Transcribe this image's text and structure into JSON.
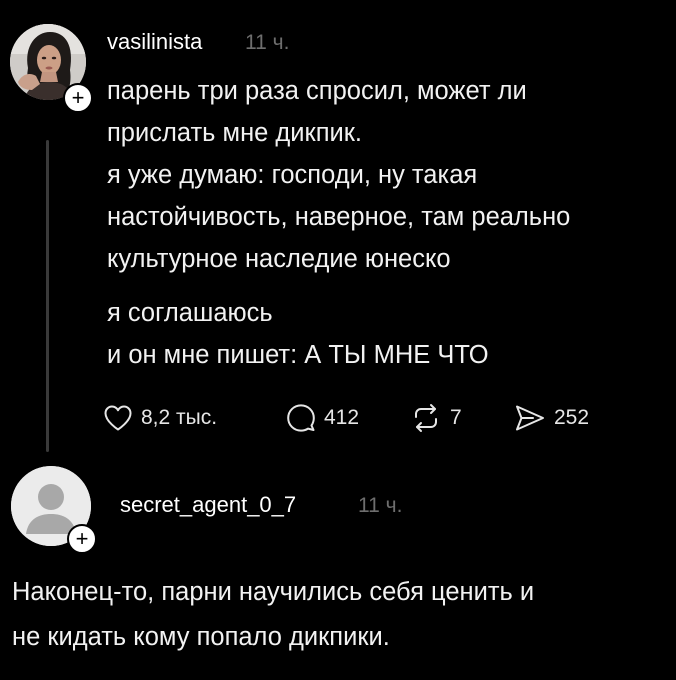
{
  "post": {
    "username": "vasilinista",
    "time": "11 ч.",
    "lines_block1": [
      "парень три раза спросил, может ли",
      "прислать мне дикпик.",
      "я уже думаю: господи, ну такая",
      "настойчивость, наверное, там реально",
      "культурное наследие юнеско"
    ],
    "lines_block2": [
      "я соглашаюсь",
      "и он мне пишет: А ТЫ МНЕ ЧТО"
    ],
    "actions": {
      "likes": "8,2 тыс.",
      "comments": "412",
      "reposts": "7",
      "shares": "252"
    },
    "follow_badge": "+"
  },
  "reply": {
    "username": "secret_agent_0_7",
    "time": "11 ч.",
    "lines": [
      "Наконец-то, парни научились себя ценить и",
      "не кидать кому попало дикпики."
    ],
    "follow_badge": "+"
  },
  "icons": {
    "like": "heart-icon",
    "comment": "comment-bubble-icon",
    "repost": "repost-icon",
    "share": "share-icon",
    "follow": "plus-icon",
    "default_avatar": "default-avatar-icon"
  },
  "colors": {
    "background": "#000000",
    "text": "#f2f2f2",
    "muted": "#6e6e6e",
    "thread_line": "#3a3a3a",
    "badge": "#ffffff",
    "default_avatar_bg": "#ebebeb",
    "default_avatar_fg": "#a8a8a8"
  }
}
